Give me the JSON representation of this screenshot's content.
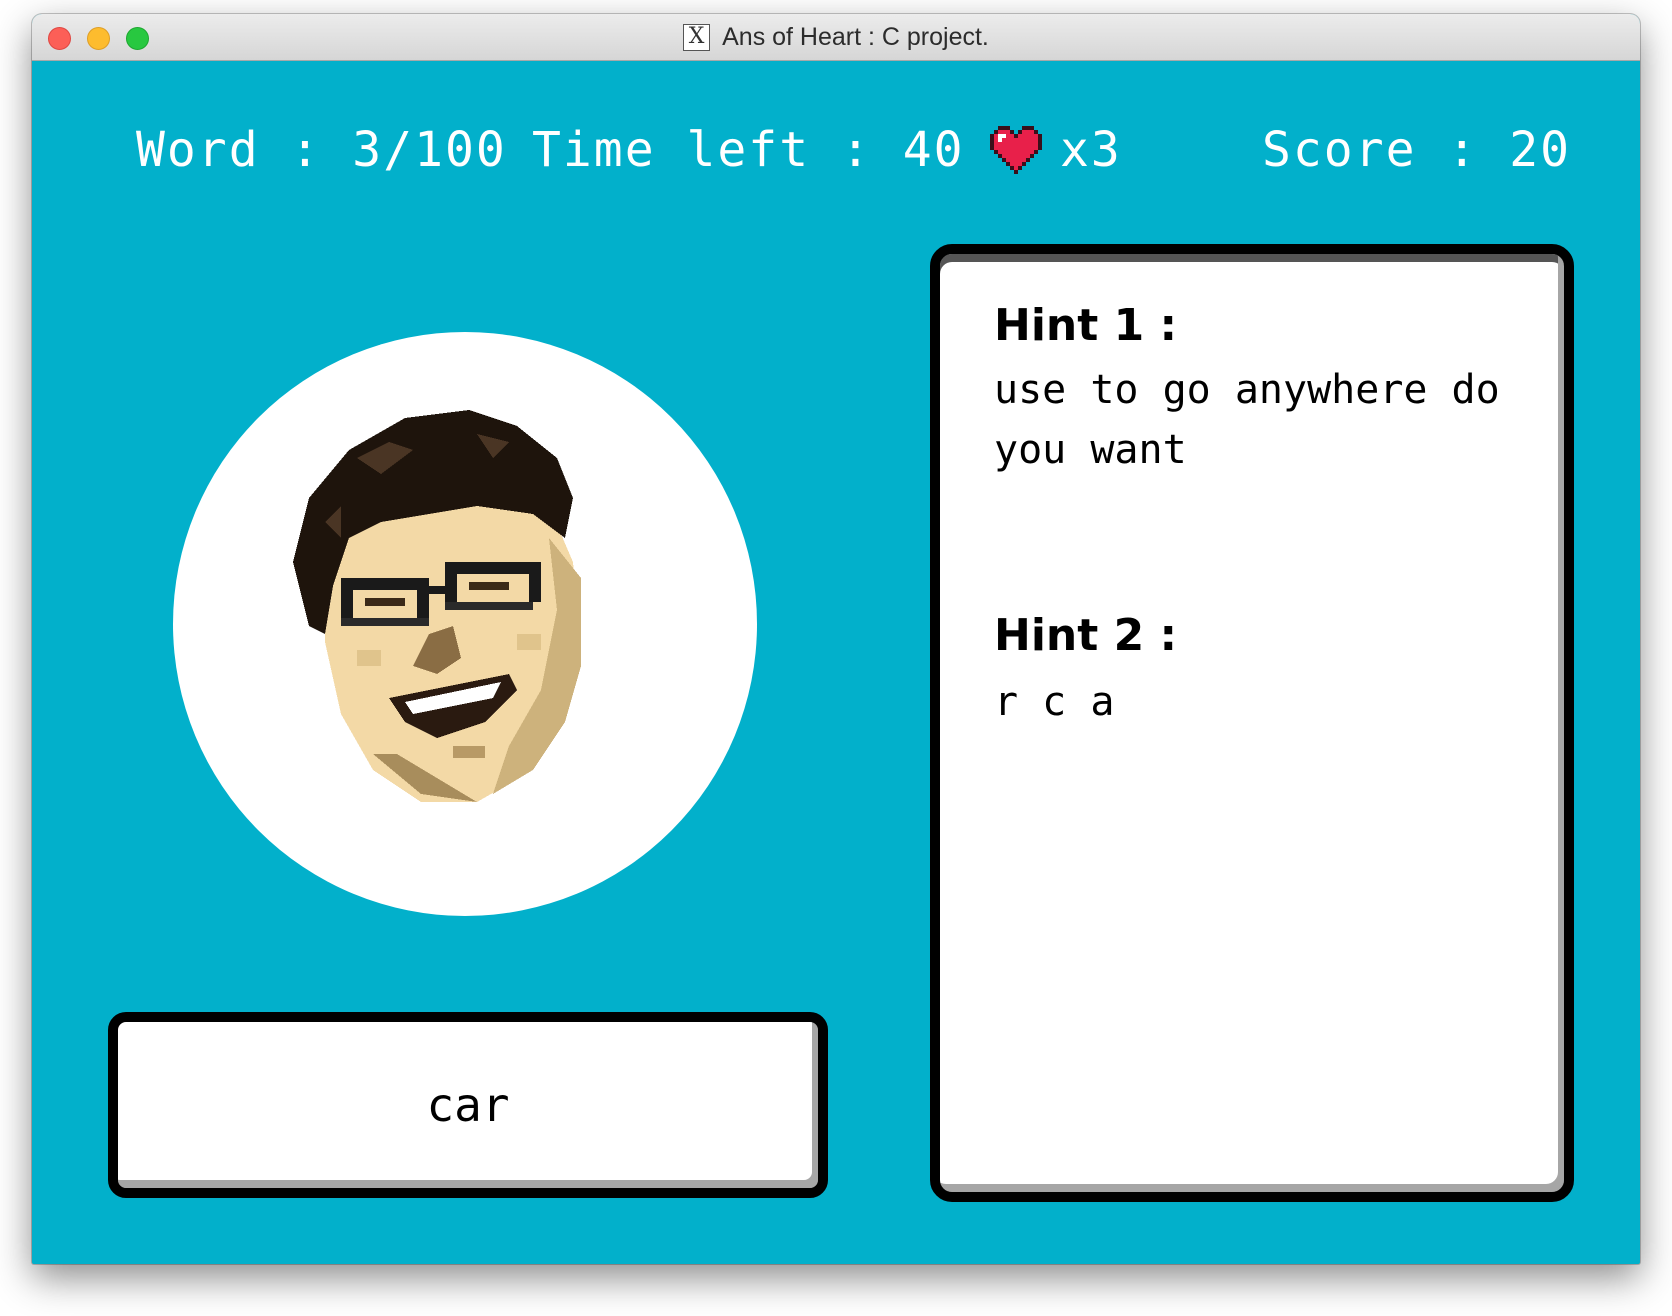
{
  "window": {
    "title": "Ans of Heart : C project.",
    "app_icon": "x11-icon"
  },
  "hud": {
    "word_progress": "Word : 3/100",
    "time_left": "Time left : 40",
    "lives": "x3",
    "lives_icon": "heart-icon",
    "score": "Score : 20"
  },
  "portrait": {
    "icon": "pixel-face-portrait"
  },
  "answer": {
    "text": "car"
  },
  "hints": {
    "hint1_title": "Hint 1 :",
    "hint1_text": "use to go anywhere do you want",
    "hint2_title": "Hint 2 :",
    "hint2_text": "r c a"
  },
  "colors": {
    "background": "#02b0cb",
    "text_light": "#ffffff",
    "heart": "#e8204a"
  }
}
